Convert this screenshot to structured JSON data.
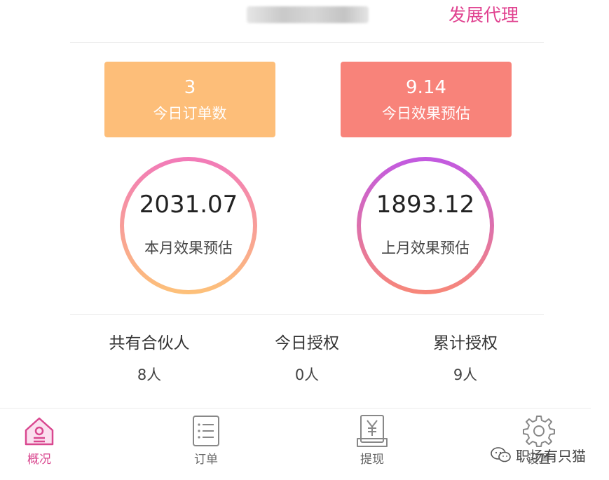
{
  "header": {
    "develop_link": "发展代理"
  },
  "cards": {
    "orders": {
      "value": "3",
      "label": "今日订单数",
      "color": "#fdbe79"
    },
    "effect_today": {
      "value": "9.14",
      "label": "今日效果预估",
      "color": "#f8837a"
    }
  },
  "rings": {
    "this_month": {
      "value": "2031.07",
      "label": "本月效果预估"
    },
    "last_month": {
      "value": "1893.12",
      "label": "上月效果预估"
    }
  },
  "stats": {
    "partners": {
      "title": "共有合伙人",
      "count": "8人"
    },
    "today_auth": {
      "title": "今日授权",
      "count": "0人"
    },
    "total_auth": {
      "title": "累计授权",
      "count": "9人"
    }
  },
  "tabs": [
    {
      "label": "概况",
      "icon": "home-icon",
      "active": true
    },
    {
      "label": "订单",
      "icon": "list-icon",
      "active": false
    },
    {
      "label": "提现",
      "icon": "yuan-receipt-icon",
      "active": false
    },
    {
      "label": "设置",
      "icon": "gear-icon",
      "active": false
    }
  ],
  "watermark": {
    "text": "职场有只猫"
  },
  "colors": {
    "accent": "#d9478f",
    "link": "#e0418f",
    "ring_left_top": "#f27bb8",
    "ring_left_bottom": "#fdc07a",
    "ring_right_top": "#c25ae0",
    "ring_right_bottom": "#f7877a"
  }
}
